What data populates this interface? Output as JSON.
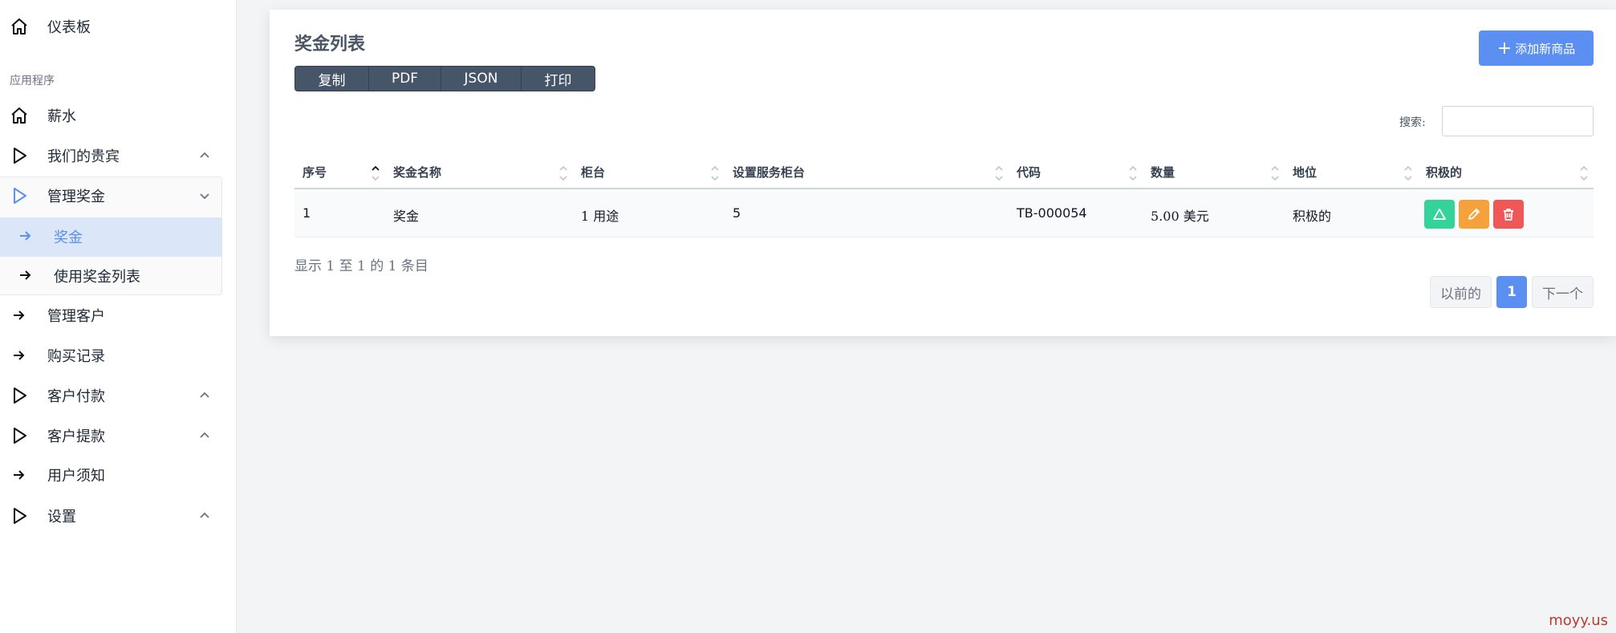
{
  "sidebar": {
    "dashboard": "仪表板",
    "section_label": "应用程序",
    "items": [
      {
        "label": "薪水"
      },
      {
        "label": "我们的贵宾"
      },
      {
        "label": "管理奖金"
      },
      {
        "label": "管理客户"
      },
      {
        "label": "购买记录"
      },
      {
        "label": "客户付款"
      },
      {
        "label": "客户提款"
      },
      {
        "label": "用户须知"
      },
      {
        "label": "设置"
      }
    ],
    "submenu": [
      {
        "label": "奖金"
      },
      {
        "label": "使用奖金列表"
      }
    ]
  },
  "card": {
    "title": "奖金列表",
    "export_buttons": [
      "复制",
      "PDF",
      "JSON",
      "打印"
    ],
    "add_button": "添加新商品",
    "search_label": "搜索:",
    "search_value": ""
  },
  "table": {
    "headers": [
      "序号",
      "奖金名称",
      "柜台",
      "设置服务柜台",
      "代码",
      "数量",
      "地位",
      "积极的"
    ],
    "rows": [
      {
        "cells": [
          "1",
          "奖金",
          "1 用途",
          "5",
          "TB-000054",
          "5.00 美元",
          "积极的"
        ]
      }
    ]
  },
  "info_text": "显示 1 至 1 的 1 条目",
  "pagination": {
    "prev": "以前的",
    "page": "1",
    "next": "下一个"
  },
  "colors": {
    "accent": "#5b8ff2",
    "success": "#34d399",
    "warning": "#f5a23d",
    "danger": "#f05757"
  },
  "watermark": "moyy.us"
}
